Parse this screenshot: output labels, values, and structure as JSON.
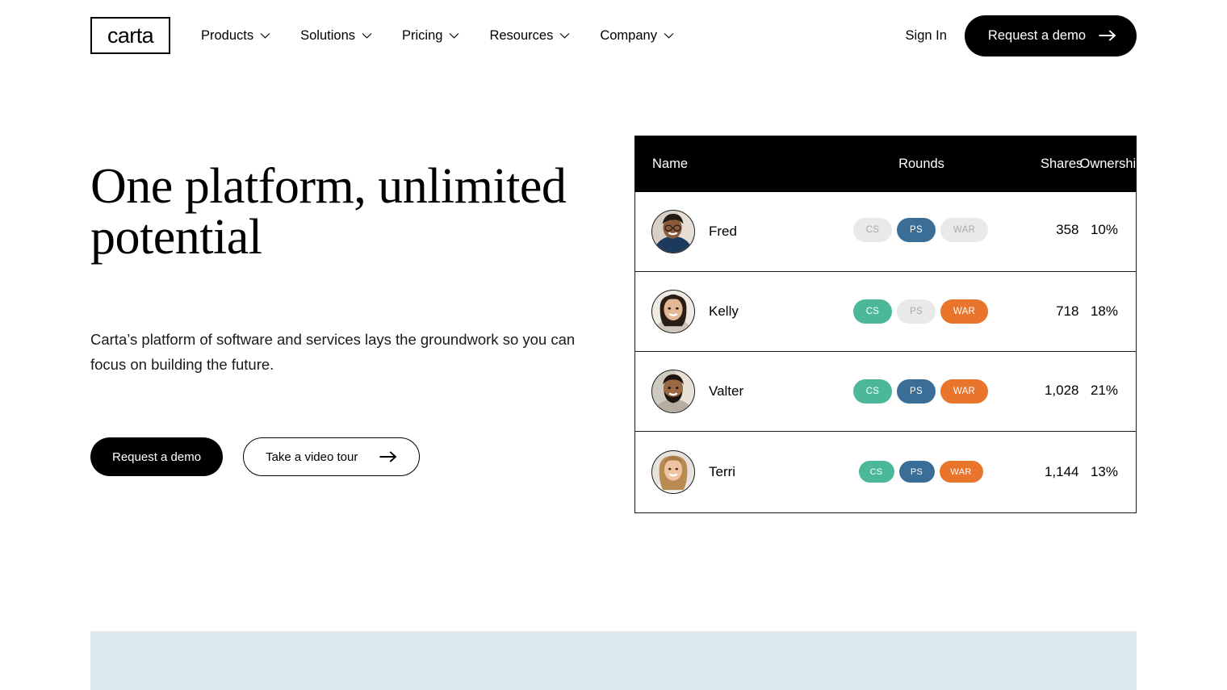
{
  "nav": {
    "logo": "carta",
    "items": [
      {
        "label": "Products"
      },
      {
        "label": "Solutions"
      },
      {
        "label": "Pricing"
      },
      {
        "label": "Resources"
      },
      {
        "label": "Company"
      }
    ],
    "signin": "Sign In",
    "demo_button": "Request a demo"
  },
  "hero": {
    "title": "One platform, unlimited potential",
    "subtitle": "Carta’s platform of software and services lays the groundwork so you can focus on building the future.",
    "primary_cta": "Request a demo",
    "secondary_cta": "Take a video tour"
  },
  "cap_table": {
    "columns": {
      "name": "Name",
      "rounds": "Rounds",
      "shares": "Shares",
      "ownership": "Ownership"
    },
    "rows": [
      {
        "name": "Fred",
        "rounds": [
          {
            "label": "CS",
            "state": "off"
          },
          {
            "label": "PS",
            "state": "ps"
          },
          {
            "label": "WAR",
            "state": "off"
          }
        ],
        "shares": "358",
        "ownership": "10%"
      },
      {
        "name": "Kelly",
        "rounds": [
          {
            "label": "CS",
            "state": "cs"
          },
          {
            "label": "PS",
            "state": "off"
          },
          {
            "label": "WAR",
            "state": "war"
          }
        ],
        "shares": "718",
        "ownership": "18%"
      },
      {
        "name": "Valter",
        "rounds": [
          {
            "label": "CS",
            "state": "cs"
          },
          {
            "label": "PS",
            "state": "ps"
          },
          {
            "label": "WAR",
            "state": "war"
          }
        ],
        "shares": "1,028",
        "ownership": "21%"
      },
      {
        "name": "Terri",
        "rounds": [
          {
            "label": "CS",
            "state": "cs"
          },
          {
            "label": "PS",
            "state": "ps"
          },
          {
            "label": "WAR",
            "state": "war"
          }
        ],
        "shares": "1,144",
        "ownership": "13%"
      }
    ]
  },
  "colors": {
    "accent_cs": "#4CB89A",
    "accent_ps": "#3B6E96",
    "accent_war": "#E8752B",
    "badge_off": "#E9E9E9",
    "badge_off_text": "#A9A9A9",
    "header_bg": "#000000",
    "band_bg": "#DBE8EF"
  },
  "icons": {
    "chevron_down": "chevron-down-icon",
    "arrow_right": "arrow-right-icon"
  }
}
